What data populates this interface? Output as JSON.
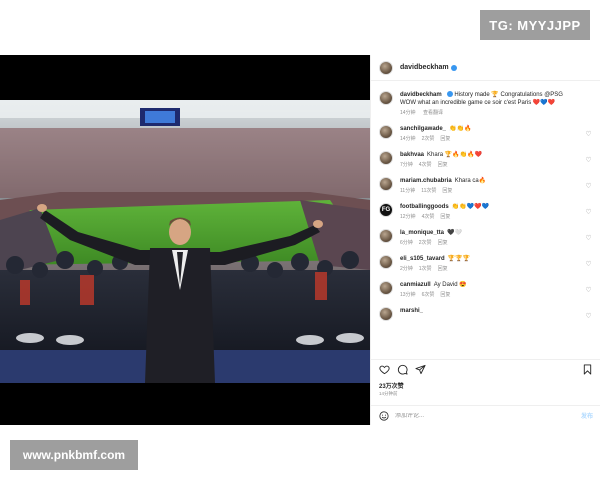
{
  "watermarks": {
    "top": "TG: MYYJJPP",
    "bottom": "www.pnkbmf.com"
  },
  "post": {
    "author": "davidbeckham",
    "caption_author": "davidbeckham",
    "caption_text": "History made 🏆 Congratulations @PSG WOW what an incredible game ce soir c'est Paris ❤️💙❤️",
    "caption_time": "14分钟",
    "caption_translate": "查看翻译",
    "likes": "23万次赞",
    "date": "14分钟前",
    "add_comment_placeholder": "添加评论...",
    "post_label": "发布"
  },
  "comments": [
    {
      "user": "sanchilgawade_",
      "text": "👏👏🔥",
      "time": "14分钟",
      "likes": "2次赞",
      "reply": "回复"
    },
    {
      "user": "bakhvaa",
      "text": "Khara 🏆🔥👏🔥❤️",
      "time": "7分钟",
      "likes": "4次赞",
      "reply": "回复"
    },
    {
      "user": "mariam.chubabria",
      "text": "Khara ca🔥",
      "time": "11分钟",
      "likes": "11次赞",
      "reply": "回复"
    },
    {
      "user": "footballinggoods",
      "text": "👏👏💙❤️💙",
      "time": "12分钟",
      "likes": "4次赞",
      "reply": "回复"
    },
    {
      "user": "la_monique_tta",
      "text": "🖤🤍",
      "time": "6分钟",
      "likes": "2次赞",
      "reply": "回复"
    },
    {
      "user": "eli_s105_tavard",
      "text": "🏆🏆🏆",
      "time": "2分钟",
      "likes": "1次赞",
      "reply": "回复"
    },
    {
      "user": "canmiazull",
      "text": "Ay David 😍",
      "time": "13分钟",
      "likes": "6次赞",
      "reply": "回复"
    },
    {
      "user": "marshi_",
      "text": "",
      "time": "",
      "likes": "",
      "reply": ""
    }
  ],
  "icons": {
    "like": "heart-icon",
    "comment": "comment-icon",
    "share": "share-icon",
    "save": "bookmark-icon",
    "emoji": "emoji-icon"
  },
  "colors": {
    "verified": "#3897f0",
    "text": "#262626",
    "muted": "#8e8e8e",
    "watermark_bg": "#9e9e9e"
  }
}
